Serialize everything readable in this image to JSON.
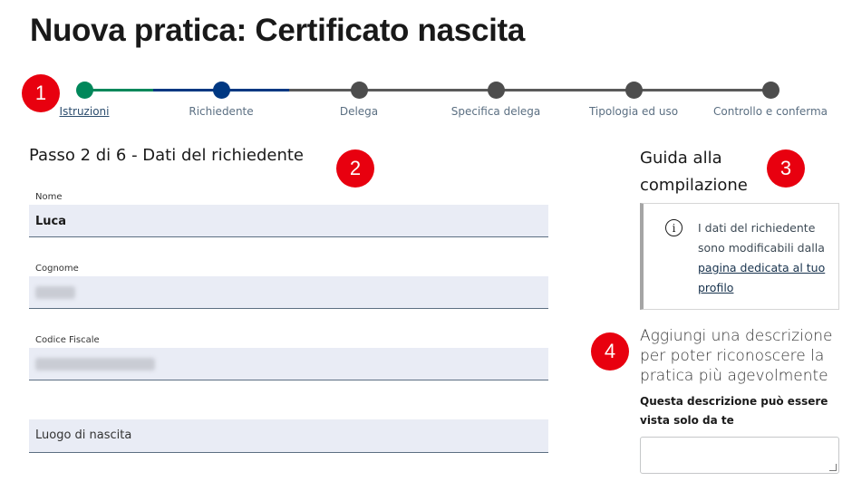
{
  "page": {
    "title": "Nuova pratica: Certificato nascita"
  },
  "stepper": {
    "steps": [
      {
        "label": "Istruzioni",
        "state": "done",
        "color": "#00875a"
      },
      {
        "label": "Richiedente",
        "state": "current",
        "color": "#003882"
      },
      {
        "label": "Delega",
        "state": "todo",
        "color": "#4d4d4d"
      },
      {
        "label": "Specifica delega",
        "state": "todo",
        "color": "#4d4d4d"
      },
      {
        "label": "Tipologia ed uso",
        "state": "todo",
        "color": "#4d4d4d"
      },
      {
        "label": "Controllo e conferma",
        "state": "todo",
        "color": "#4d4d4d"
      }
    ]
  },
  "markers": [
    "1",
    "2",
    "3",
    "4"
  ],
  "form": {
    "section_title": "Passo 2 di 6 - Dati del richiedente",
    "fields": [
      {
        "label": "Nome",
        "value": "Luca"
      },
      {
        "label": "Cognome",
        "value": ""
      },
      {
        "label": "Codice Fiscale",
        "value": ""
      },
      {
        "label": "",
        "placeholder": "Luogo di nascita"
      }
    ]
  },
  "guide": {
    "title_line1": "Guida alla",
    "title_line2": "compilazione",
    "text": "I dati del richiedente sono modificabili dalla",
    "link": "pagina dedicata al tuo profilo"
  },
  "description": {
    "title": "Aggiungi una descrizione per poter riconoscere la pratica più agevolmente",
    "note": "Questa descrizione può essere vista solo da te",
    "value": ""
  },
  "colors": {
    "marker": "#e8000f",
    "field_bg": "#e9ecf5"
  }
}
